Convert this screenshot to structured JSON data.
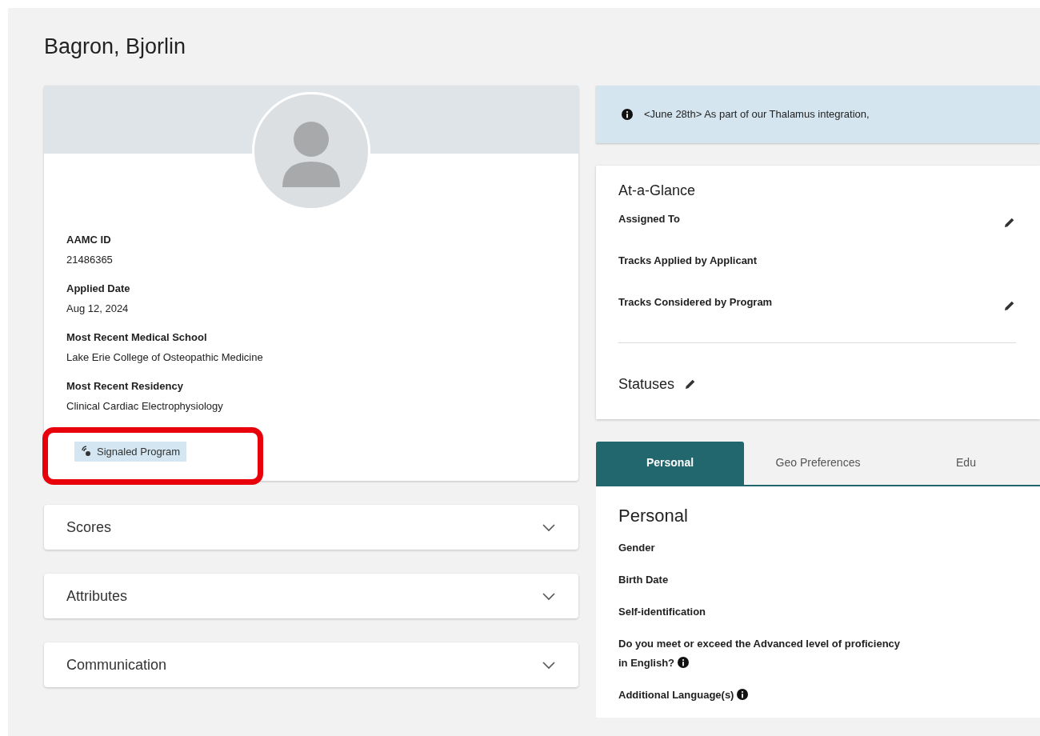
{
  "title": "Bagron, Bjorlin",
  "profile": {
    "fields": [
      {
        "label": "AAMC ID",
        "value": "21486365"
      },
      {
        "label": "Applied Date",
        "value": "Aug 12, 2024"
      },
      {
        "label": "Most Recent Medical School",
        "value": "Lake Erie College of Osteopathic Medicine"
      },
      {
        "label": "Most Recent Residency",
        "value": "Clinical Cardiac Electrophysiology"
      }
    ],
    "badge": "Signaled Program",
    "highlighted": true
  },
  "sections": [
    {
      "label": "Scores",
      "expanded": false
    },
    {
      "label": "Attributes",
      "expanded": false
    },
    {
      "label": "Communication",
      "expanded": false
    }
  ],
  "notice": "<June 28th> As part of our Thalamus integration,",
  "at_a_glance": {
    "title": "At-a-Glance",
    "items": [
      {
        "label": "Assigned To",
        "editable": true
      },
      {
        "label": "Tracks Applied by Applicant",
        "editable": false
      },
      {
        "label": "Tracks Considered by Program",
        "editable": true
      }
    ],
    "statuses": "Statuses"
  },
  "tabs": [
    {
      "label": "Personal",
      "selected": true
    },
    {
      "label": "Geo Preferences",
      "selected": false
    },
    {
      "label": "Edu",
      "selected": false
    }
  ],
  "personal": {
    "title": "Personal",
    "fields": [
      {
        "label": "Gender",
        "info": false
      },
      {
        "label": "Birth Date",
        "info": false
      },
      {
        "label": "Self-identification",
        "info": false
      },
      {
        "label": "Do you meet or exceed the Advanced level of proficiency in English?",
        "info": true
      },
      {
        "label": "Additional Language(s)",
        "info": true
      }
    ]
  }
}
